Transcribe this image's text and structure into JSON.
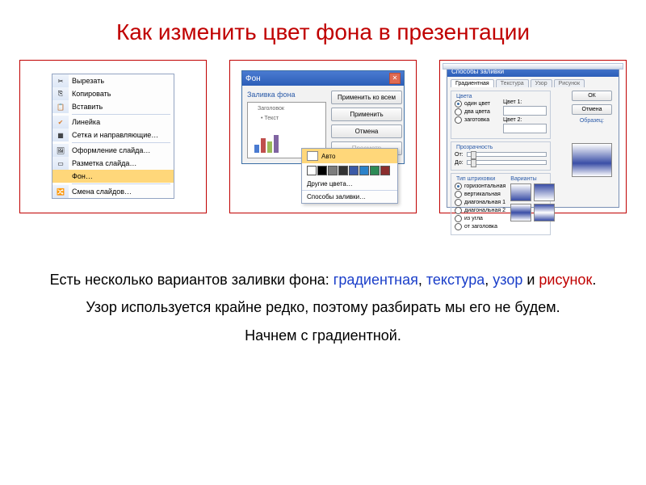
{
  "title": "Как изменить цвет фона в презентации",
  "context_menu": {
    "items": [
      {
        "icon": "✂",
        "label": "Вырезать"
      },
      {
        "icon": "⎘",
        "label": "Копировать"
      },
      {
        "icon": "📋",
        "label": "Вставить"
      },
      {
        "icon": "✔",
        "label": "Линейка",
        "checked": true
      },
      {
        "icon": "▦",
        "label": "Сетка и направляющие…"
      },
      {
        "icon": "🖼",
        "label": "Оформление слайда…"
      },
      {
        "icon": "▭",
        "label": "Разметка слайда…"
      },
      {
        "icon": "",
        "label": "Фон…",
        "selected": true
      },
      {
        "icon": "🔀",
        "label": "Смена слайдов…"
      }
    ]
  },
  "bg_dialog": {
    "title": "Фон",
    "section_label": "Заливка фона",
    "preview": {
      "title_text": "Заголовок",
      "body_text": "• Текст"
    },
    "buttons": {
      "apply_all": "Применить ко всем",
      "apply": "Применить",
      "cancel": "Отмена",
      "preview": "Просмотр"
    },
    "color_popup": {
      "auto": "Авто",
      "swatches": [
        "#fff",
        "#000",
        "#7d7d7d",
        "#333",
        "#3b5aa6",
        "#2c82c9",
        "#2e8b57",
        "#8b2e2e"
      ],
      "more": "Другие цвета…",
      "fill_methods": "Способы заливки…"
    }
  },
  "fill_dialog": {
    "title": "Способы заливки",
    "tabs": [
      "Градиентная",
      "Текстура",
      "Узор",
      "Рисунок"
    ],
    "group_colors": "Цвета",
    "radios_colors": [
      "один цвет",
      "два цвета",
      "заготовка"
    ],
    "color1": "Цвет 1:",
    "color2": "Цвет 2:",
    "group_trans": "Прозрачность",
    "trans_from": "От:",
    "trans_to": "До:",
    "group_shading": "Тип штриховки",
    "radios_shading": [
      "горизонтальная",
      "вертикальная",
      "диагональная 1",
      "диагональная 2",
      "из угла",
      "от заголовка"
    ],
    "variants_label": "Варианты",
    "sample_label": "Образец:",
    "ok": "ОК",
    "cancel": "Отмена"
  },
  "paragraphs": {
    "p1_lead": "Есть несколько вариантов заливки фона: ",
    "p1_grad": "градиентная",
    "p1_sep": ", ",
    "p1_tex": "текстура",
    "p1_uzor": "узор",
    "p1_and": " и ",
    "p1_pic": "рисунок",
    "p1_end": ".",
    "p2": "Узор используется крайне редко, поэтому разбирать мы его не будем.",
    "p3": "Начнем с градиентной."
  }
}
